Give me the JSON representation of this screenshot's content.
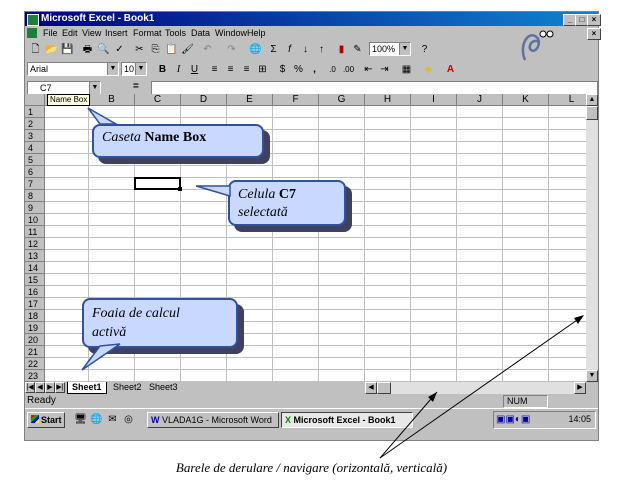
{
  "window": {
    "title": "Microsoft Excel - Book1"
  },
  "menu": [
    "File",
    "Edit",
    "View",
    "Insert",
    "Format",
    "Tools",
    "Data",
    "Window",
    "Help"
  ],
  "toolbar": {
    "zoom": "100%",
    "font": "Arial",
    "size": "10",
    "percent": "%",
    "comma": ","
  },
  "formula_bar": {
    "name_box": "C7",
    "equals": "=",
    "tooltip": "Name Box"
  },
  "columns": [
    "A",
    "B",
    "C",
    "D",
    "E",
    "F",
    "G",
    "H",
    "I",
    "J",
    "K",
    "L"
  ],
  "rows": [
    "1",
    "2",
    "3",
    "4",
    "5",
    "6",
    "7",
    "8",
    "9",
    "10",
    "11",
    "12",
    "13",
    "14",
    "15",
    "16",
    "17",
    "18",
    "19",
    "20",
    "21",
    "22",
    "23"
  ],
  "selected_cell": {
    "column": "C",
    "row": "7"
  },
  "sheets": [
    "Sheet1",
    "Sheet2",
    "Sheet3"
  ],
  "active_sheet": "Sheet1",
  "status": {
    "left": "Ready",
    "num": "NUM"
  },
  "taskbar": {
    "start": "Start",
    "task1": "VLADA1G - Microsoft Word",
    "task2": "Microsoft Excel - Book1",
    "clock": "14:05"
  },
  "callouts": {
    "name_box_pre": "Caseta",
    "name_box_bold": "Name Box",
    "cell_pre": "Celula",
    "cell_bold": "C7",
    "cell_post": "selectată",
    "sheet_line1": "Foaia de calcul",
    "sheet_line2": "activă"
  },
  "caption": "Barele de derulare / navigare (orizontală, verticală)"
}
